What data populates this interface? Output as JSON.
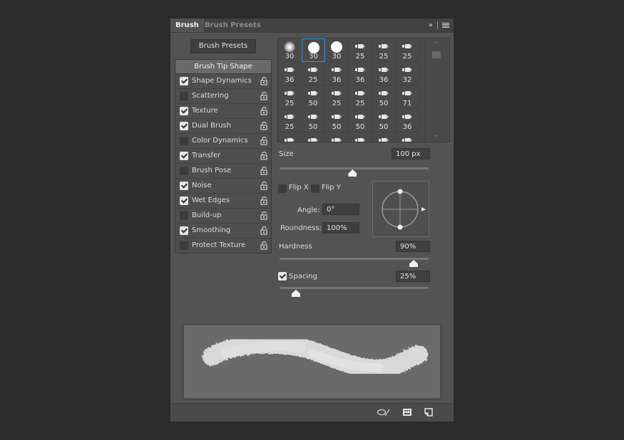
{
  "tabs": [
    {
      "label": "Brush",
      "active": true
    },
    {
      "label": "Brush Presets",
      "active": false
    }
  ],
  "tab_controls": {
    "collapse_icon": "double-chevron-right-icon",
    "menu_icon": "hamburger-menu-icon",
    "collapse_glyph": "»"
  },
  "brush_presets_button": "Brush Presets",
  "options": {
    "header": "Brush Tip Shape",
    "items": [
      {
        "label": "Shape Dynamics",
        "checked": true
      },
      {
        "label": "Scattering",
        "checked": false
      },
      {
        "label": "Texture",
        "checked": true
      },
      {
        "label": "Dual Brush",
        "checked": true
      },
      {
        "label": "Color Dynamics",
        "checked": false
      },
      {
        "label": "Transfer",
        "checked": true
      },
      {
        "label": "Brush Pose",
        "checked": false
      },
      {
        "label": "Noise",
        "checked": true
      },
      {
        "label": "Wet Edges",
        "checked": true
      },
      {
        "label": "Build-up",
        "checked": false
      },
      {
        "label": "Smoothing",
        "checked": true
      },
      {
        "label": "Protect Texture",
        "checked": false
      }
    ]
  },
  "brush_tips": [
    {
      "size": "30",
      "kind": "soft"
    },
    {
      "size": "30",
      "kind": "hard",
      "selected": true
    },
    {
      "size": "30",
      "kind": "hard"
    },
    {
      "size": "25",
      "kind": "shape"
    },
    {
      "size": "25",
      "kind": "shape"
    },
    {
      "size": "25",
      "kind": "shape"
    },
    {
      "size": "36",
      "kind": "shape"
    },
    {
      "size": "25",
      "kind": "shape"
    },
    {
      "size": "36",
      "kind": "shape"
    },
    {
      "size": "36",
      "kind": "shape"
    },
    {
      "size": "36",
      "kind": "shape"
    },
    {
      "size": "32",
      "kind": "shape"
    },
    {
      "size": "25",
      "kind": "shape"
    },
    {
      "size": "50",
      "kind": "shape"
    },
    {
      "size": "25",
      "kind": "shape"
    },
    {
      "size": "25",
      "kind": "shape"
    },
    {
      "size": "50",
      "kind": "shape"
    },
    {
      "size": "71",
      "kind": "shape"
    },
    {
      "size": "25",
      "kind": "shape"
    },
    {
      "size": "50",
      "kind": "shape"
    },
    {
      "size": "50",
      "kind": "shape"
    },
    {
      "size": "50",
      "kind": "shape"
    },
    {
      "size": "50",
      "kind": "shape"
    },
    {
      "size": "36",
      "kind": "shape"
    },
    {
      "size": "",
      "kind": "shape"
    },
    {
      "size": "",
      "kind": "shape"
    },
    {
      "size": "",
      "kind": "shape"
    },
    {
      "size": "",
      "kind": "shape"
    },
    {
      "size": "",
      "kind": "shape"
    },
    {
      "size": "",
      "kind": "shape"
    }
  ],
  "tip_settings": {
    "size_label": "Size",
    "size_value": "100 px",
    "size_slider_fraction": 0.49,
    "flip_x_label": "Flip X",
    "flip_x_checked": false,
    "flip_y_label": "Flip Y",
    "flip_y_checked": false,
    "angle_label": "Angle:",
    "angle_value": "0°",
    "roundness_label": "Roundness:",
    "roundness_value": "100%",
    "hardness_label": "Hardness",
    "hardness_value": "90%",
    "hardness_slider_fraction": 0.9,
    "spacing_label": "Spacing",
    "spacing_checked": true,
    "spacing_value": "25%",
    "spacing_slider_fraction": 0.11
  },
  "bottom_bar": {
    "icons": [
      "toggle-live-tip-preview-icon",
      "brush-grid-icon",
      "create-new-brush-icon"
    ]
  }
}
